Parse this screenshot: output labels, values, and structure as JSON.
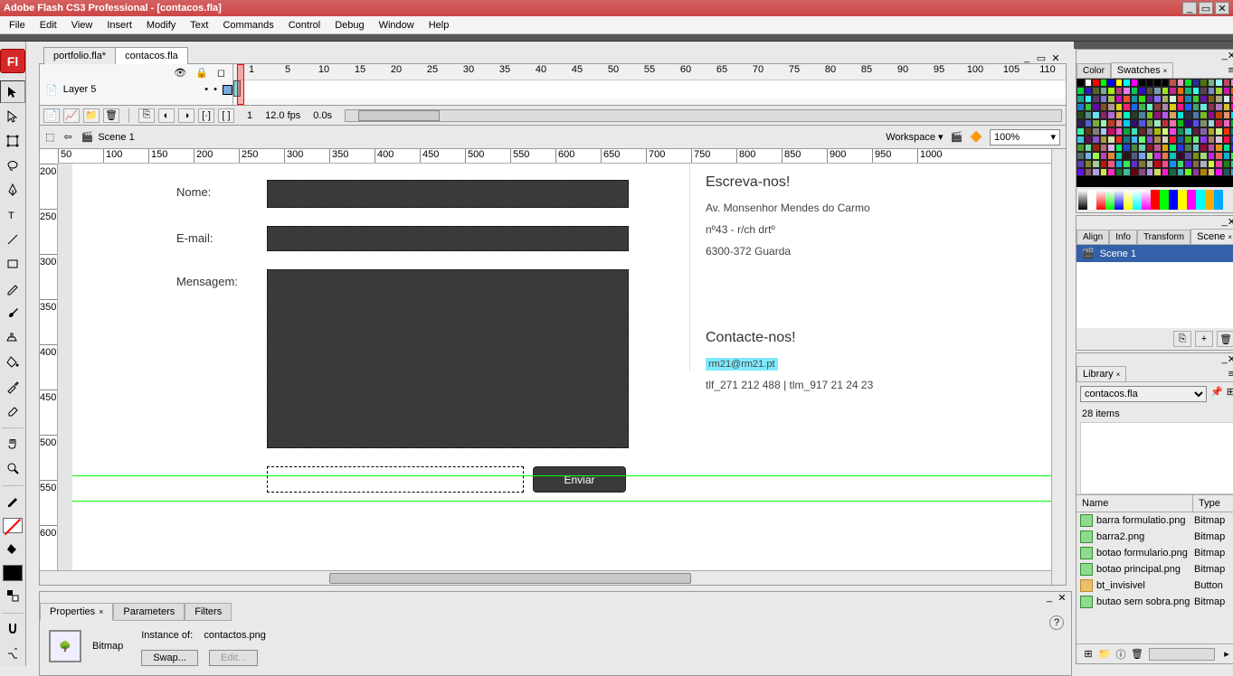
{
  "app": {
    "title": "Adobe Flash CS3 Professional - [contacos.fla]",
    "logo_letter": "Fl"
  },
  "menu": [
    "File",
    "Edit",
    "View",
    "Insert",
    "Modify",
    "Text",
    "Commands",
    "Control",
    "Debug",
    "Window",
    "Help"
  ],
  "doc_tabs": [
    {
      "label": "portfolio.fla*",
      "active": false
    },
    {
      "label": "contacos.fla",
      "active": true
    }
  ],
  "timeline": {
    "layer_name": "Layer 5",
    "frame": "1",
    "fps": "12.0 fps",
    "time": "0.0s",
    "ticks": [
      "1",
      "5",
      "10",
      "15",
      "20",
      "25",
      "30",
      "35",
      "40",
      "45",
      "50",
      "55",
      "60",
      "65",
      "70",
      "75",
      "80",
      "85",
      "90",
      "95",
      "100",
      "105",
      "110"
    ]
  },
  "editbar": {
    "scene_label": "Scene 1",
    "workspace_label": "Workspace ▾",
    "zoom": "100%"
  },
  "rulerH": [
    "50",
    "100",
    "150",
    "200",
    "250",
    "300",
    "350",
    "400",
    "450",
    "500",
    "550",
    "600",
    "650",
    "700",
    "750",
    "800",
    "850",
    "900",
    "950",
    "1000"
  ],
  "rulerV": [
    "200",
    "250",
    "300",
    "350",
    "400",
    "450",
    "500",
    "550",
    "600"
  ],
  "form": {
    "name_label": "Nome:",
    "email_label": "E-mail:",
    "message_label": "Mensagem:",
    "send_label": "Enviar",
    "info_title1": "Escreva-nos!",
    "addr1": "Av. Monsenhor Mendes do Carmo",
    "addr2": "nº43 - r/ch drtº",
    "addr3": "6300-372 Guarda",
    "info_title2": "Contacte-nos!",
    "email_link": "rm21@rm21.pt",
    "phones": "tlf_271 212 488 | tlm_917 21 24 23"
  },
  "properties": {
    "tabs": [
      "Properties",
      "Parameters",
      "Filters"
    ],
    "type_label": "Bitmap",
    "instance_label": "Instance of:",
    "instance_value": "contactos.png",
    "swap_btn": "Swap...",
    "edit_btn": "Edit..."
  },
  "panels": {
    "color_tab": "Color",
    "swatches_tab": "Swatches",
    "align_tab": "Align",
    "info_tab": "Info",
    "transform_tab": "Transform",
    "scene_tab": "Scene",
    "scene_item": "Scene 1",
    "library_tab": "Library",
    "library_doc": "contacos.fla",
    "library_count": "28 items",
    "lib_head_name": "Name",
    "lib_head_type": "Type",
    "lib_items": [
      {
        "name": "barra formulatio.png",
        "type": "Bitmap",
        "kind": "bmp"
      },
      {
        "name": "barra2.png",
        "type": "Bitmap",
        "kind": "bmp"
      },
      {
        "name": "botao formulario.png",
        "type": "Bitmap",
        "kind": "bmp"
      },
      {
        "name": "botao principal.png",
        "type": "Bitmap",
        "kind": "bmp"
      },
      {
        "name": "bt_invisivel",
        "type": "Button",
        "kind": "btn"
      },
      {
        "name": "butao sem sobra.png",
        "type": "Bitmap",
        "kind": "bmp"
      }
    ]
  }
}
